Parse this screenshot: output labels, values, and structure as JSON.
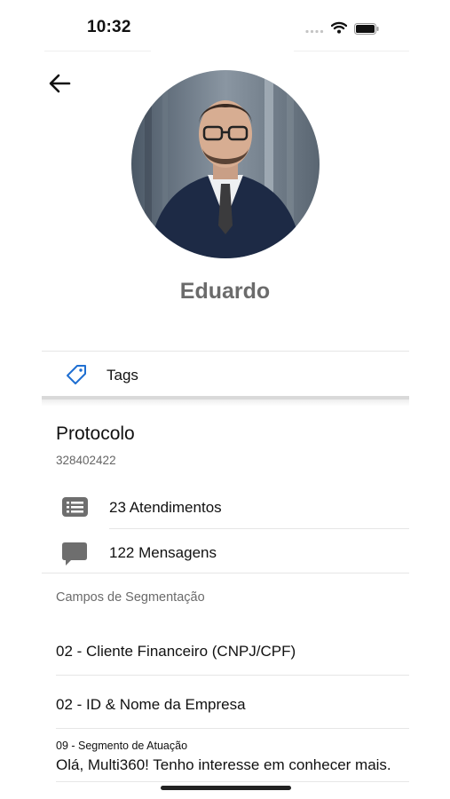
{
  "status_bar": {
    "time": "10:32"
  },
  "profile": {
    "name": "Eduardo"
  },
  "tags": {
    "label": "Tags"
  },
  "protocol": {
    "title": "Protocolo",
    "number": "328402422"
  },
  "stats": {
    "attendances": "23 Atendimentos",
    "messages": "122 Mensagens"
  },
  "segmentation": {
    "title": "Campos de Segmentação",
    "fields": [
      {
        "label": "02 - Cliente Financeiro (CNPJ/CPF)"
      },
      {
        "label": "02 - ID & Nome da Empresa"
      },
      {
        "label": "09 - Segmento de Atuação",
        "value": "Olá, Multi360! Tenho interesse em conhecer mais."
      }
    ]
  },
  "colors": {
    "accent": "#1f6fd1",
    "name_gray": "#6b6b6b",
    "icon_gray": "#6e6e6e"
  },
  "icons": [
    "back-arrow-icon",
    "tag-icon",
    "list-icon",
    "chat-bubble-icon",
    "wifi-icon",
    "battery-icon",
    "signal-icon"
  ]
}
